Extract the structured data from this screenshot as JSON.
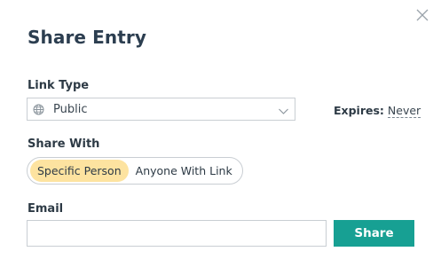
{
  "dialog": {
    "title": "Share Entry"
  },
  "link_type": {
    "label": "Link Type",
    "selected": "Public",
    "icon": "globe-icon"
  },
  "expires": {
    "label": "Expires:",
    "value": "Never"
  },
  "share_with": {
    "label": "Share With",
    "options": [
      "Specific Person",
      "Anyone With Link"
    ],
    "selected_index": 0,
    "active_color": "#fde3a0"
  },
  "email": {
    "label": "Email",
    "value": "",
    "placeholder": ""
  },
  "share_button": {
    "label": "Share",
    "color": "#17a093"
  }
}
